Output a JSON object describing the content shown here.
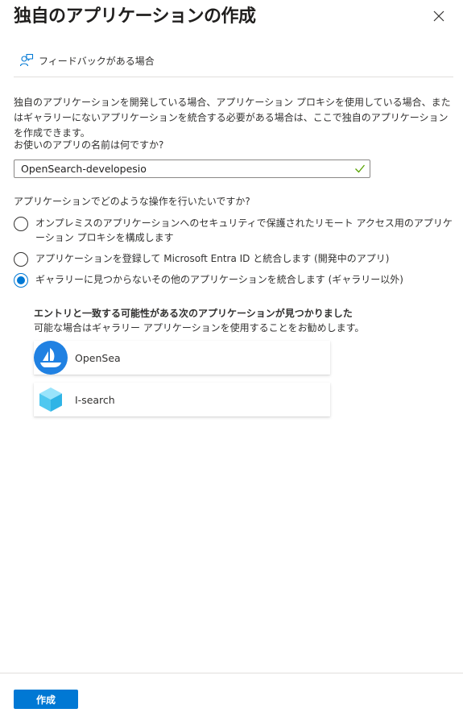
{
  "header": {
    "title": "独自のアプリケーションの作成",
    "close_icon": "close-icon"
  },
  "feedback": {
    "label": "フィードバックがある場合",
    "icon": "person-feedback-icon"
  },
  "description": "独自のアプリケーションを開発している場合、アプリケーション プロキシを使用している場合、またはギャラリーにないアプリケーションを統合する必要がある場合は、ここで独自のアプリケーションを作成できます。",
  "app_name": {
    "label": "お使いのアプリの名前は何ですか?",
    "value": "OpenSearch-developesio",
    "valid_icon": "checkmark-icon",
    "valid_color": "#57a300"
  },
  "purpose": {
    "label": "アプリケーションでどのような操作を行いたいですか?",
    "options": [
      {
        "label": "オンプレミスのアプリケーションへのセキュリティで保護されたリモート アクセス用のアプリケーション プロキシを構成します",
        "checked": false
      },
      {
        "label": "アプリケーションを登録して Microsoft Entra ID と統合します (開発中のアプリ)",
        "checked": false
      },
      {
        "label": "ギャラリーに見つからないその他のアプリケーションを統合します (ギャラリー以外)",
        "checked": true
      }
    ]
  },
  "matches": {
    "title": "エントリと一致する可能性がある次のアプリケーションが見つかりました",
    "subtitle": "可能な場合はギャラリー アプリケーションを使用することをお勧めします。",
    "apps": [
      {
        "name": "OpenSea",
        "icon": "opensea-logo-icon",
        "color": "#2081e2"
      },
      {
        "name": "I-search",
        "icon": "cube-logo-icon",
        "color": "#50c8f0"
      }
    ]
  },
  "footer": {
    "create_label": "作成",
    "accent": "#0078d4"
  }
}
